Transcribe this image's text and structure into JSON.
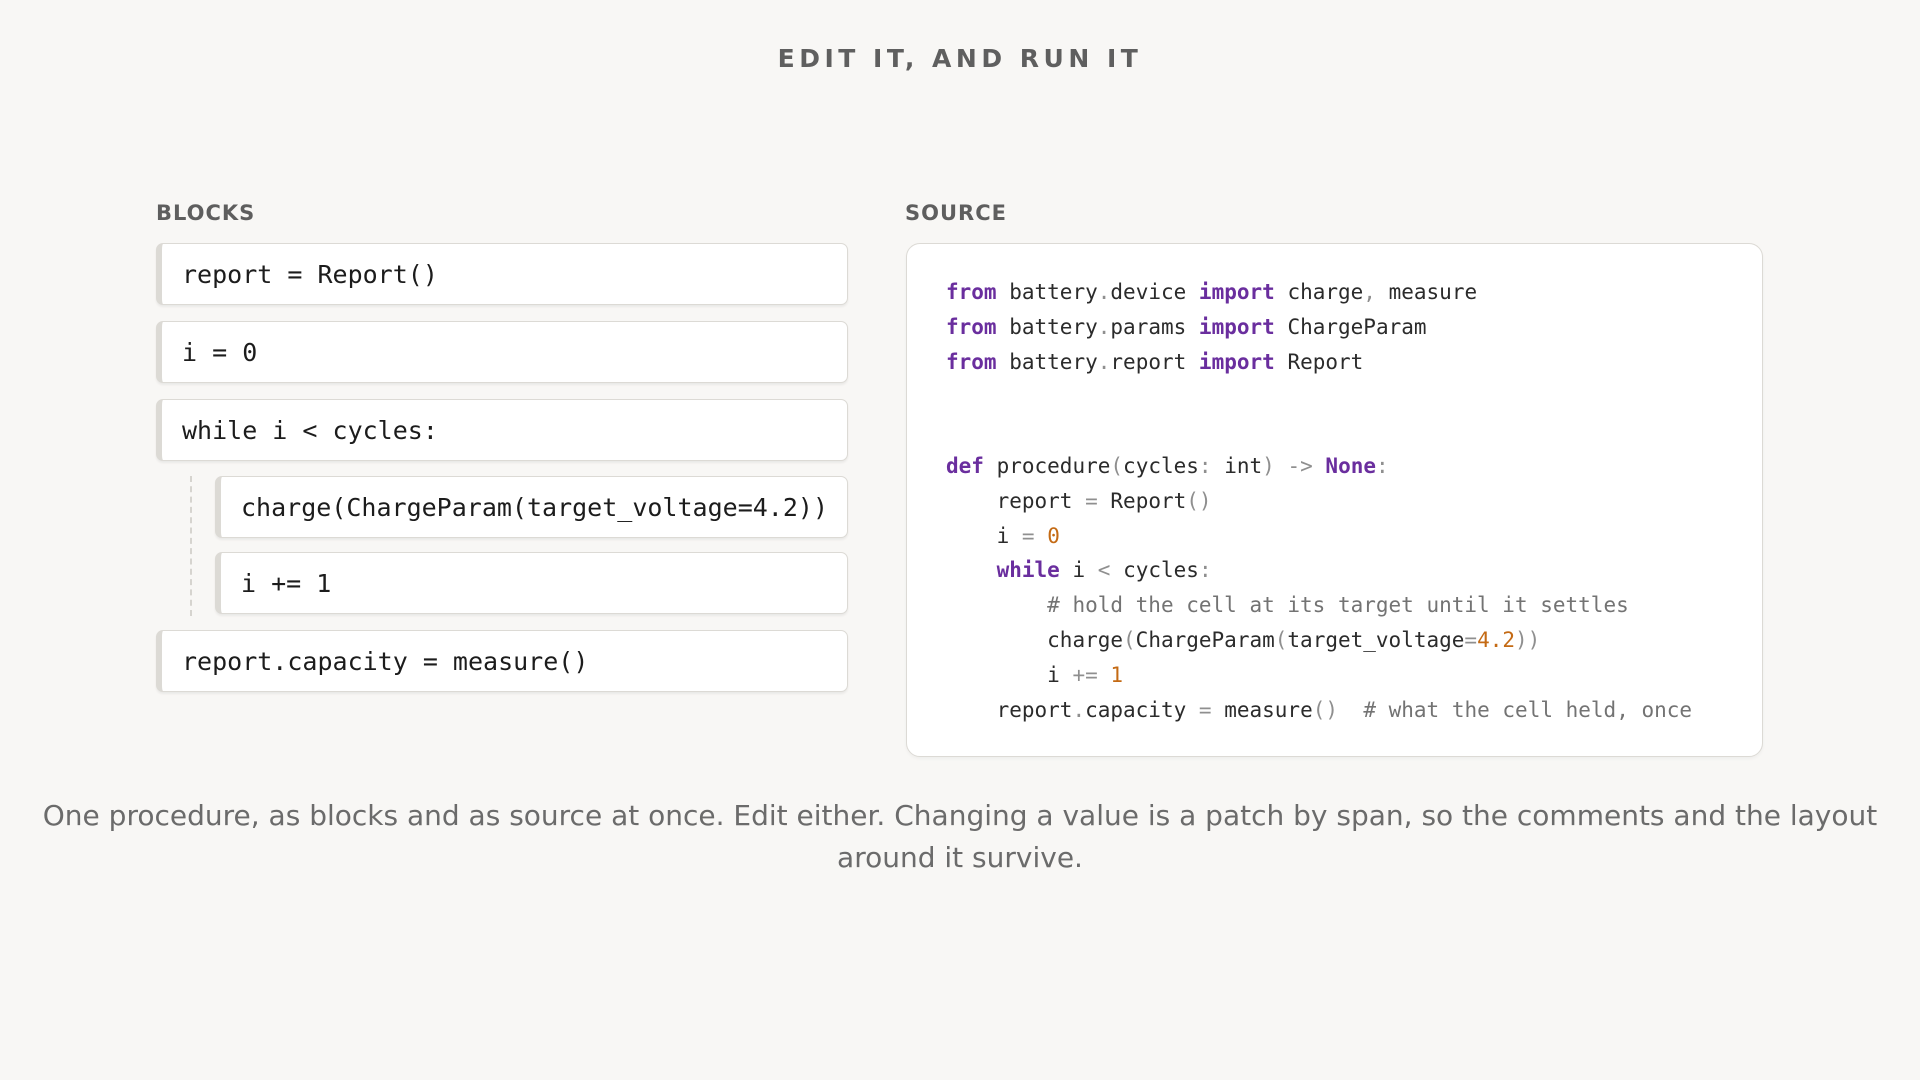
{
  "title": "EDIT IT, AND RUN IT",
  "blocks": {
    "label": "BLOCKS",
    "items": [
      {
        "text": "report = Report()"
      },
      {
        "text": "i = 0"
      },
      {
        "text": "while i < cycles:"
      },
      {
        "text": "charge(ChargeParam(target_voltage=4.2))"
      },
      {
        "text": "i += 1"
      },
      {
        "text": "report.capacity = measure()"
      }
    ]
  },
  "source": {
    "label": "SOURCE",
    "lines": [
      "from battery.device import charge, measure",
      "from battery.params import ChargeParam",
      "from battery.report import Report",
      "",
      "",
      "def procedure(cycles: int) -> None:",
      "    report = Report()",
      "    i = 0",
      "    while i < cycles:",
      "        # hold the cell at its target until it settles",
      "        charge(ChargeParam(target_voltage=4.2))",
      "        i += 1",
      "    report.capacity = measure()  # what the cell held, once"
    ]
  },
  "caption": "One procedure, as blocks and as source at once. Edit either. Changing a value is a patch by span, so the comments and the layout around it survive.",
  "colors": {
    "background": "#f8f7f5",
    "keyword": "#6a2e9e",
    "number": "#c46a14",
    "comment": "#737373"
  }
}
